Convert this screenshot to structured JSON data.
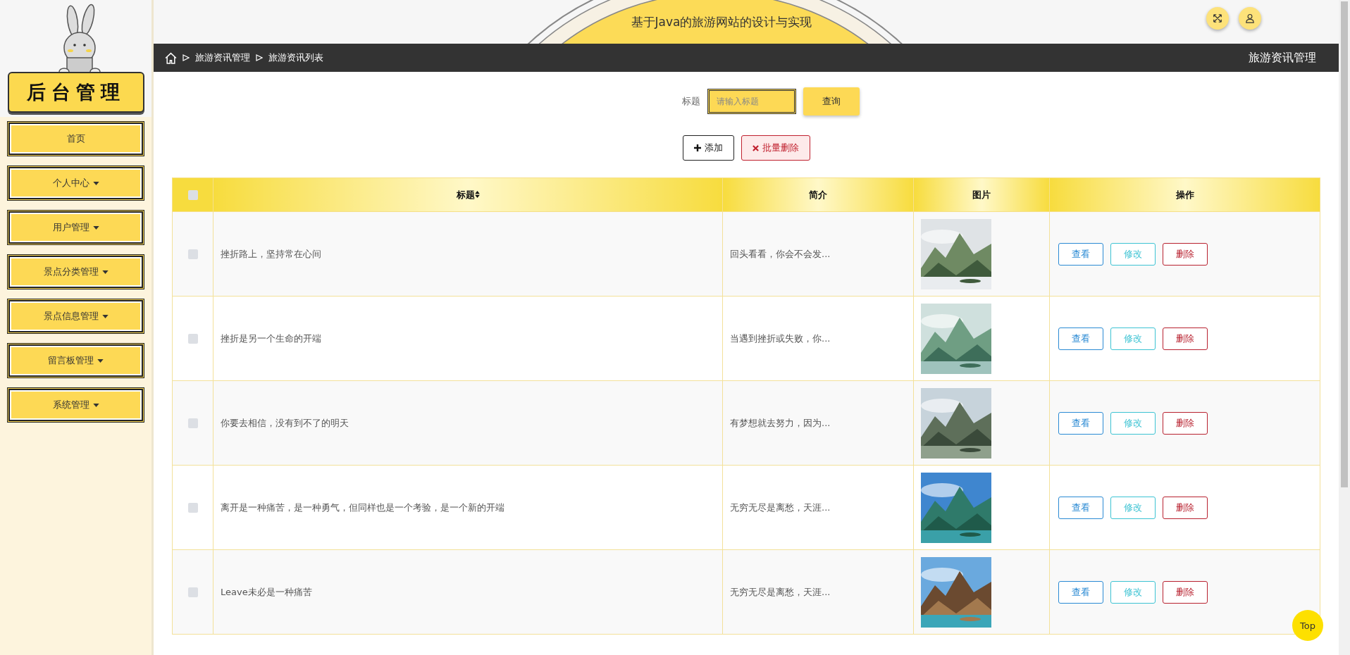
{
  "sidebar": {
    "title": "后台管理",
    "items": [
      {
        "label": "首页",
        "has_menu": false
      },
      {
        "label": "个人中心",
        "has_menu": true
      },
      {
        "label": "用户管理",
        "has_menu": true
      },
      {
        "label": "景点分类管理",
        "has_menu": true
      },
      {
        "label": "景点信息管理",
        "has_menu": true
      },
      {
        "label": "留言板管理",
        "has_menu": true
      },
      {
        "label": "系统管理",
        "has_menu": true
      }
    ]
  },
  "header": {
    "title": "基于Java的旅游网站的设计与实现"
  },
  "breadcrumb": {
    "items": [
      "旅游资讯管理",
      "旅游资讯列表"
    ],
    "page_title": "旅游资讯管理"
  },
  "search": {
    "label": "标题",
    "placeholder": "请输入标题",
    "button": "查询"
  },
  "actions": [
    {
      "kind": "add",
      "label": "添加"
    },
    {
      "kind": "delete",
      "label": "批量删除"
    }
  ],
  "table": {
    "columns": [
      "标题",
      "简介",
      "图片",
      "操作"
    ],
    "all_checked": false,
    "rows": [
      {
        "checked": false,
        "title": "挫折路上，坚持常在心间",
        "summary": "回头看看，你会不会发...",
        "picture": {
          "kind": "picture"
        },
        "buttons": [
          {
            "kind": "view",
            "label": "查看"
          },
          {
            "kind": "edit",
            "label": "修改"
          },
          {
            "kind": "delete",
            "label": "删除"
          }
        ]
      },
      {
        "checked": false,
        "title": "挫折是另一个生命的开端",
        "summary": "当遇到挫折或失败，你...",
        "picture": {
          "kind": "picture"
        },
        "buttons": [
          {
            "kind": "view",
            "label": "查看"
          },
          {
            "kind": "edit",
            "label": "修改"
          },
          {
            "kind": "delete",
            "label": "删除"
          }
        ]
      },
      {
        "checked": false,
        "title": "你要去相信，没有到不了的明天",
        "summary": "有梦想就去努力，因为...",
        "picture": {
          "kind": "picture"
        },
        "buttons": [
          {
            "kind": "view",
            "label": "查看"
          },
          {
            "kind": "edit",
            "label": "修改"
          },
          {
            "kind": "delete",
            "label": "删除"
          }
        ]
      },
      {
        "checked": false,
        "title": "离开是一种痛苦，是一种勇气，但同样也是一个考验，是一个新的开端",
        "summary": "无穷无尽是离愁，天涯...",
        "picture": {
          "kind": "picture"
        },
        "buttons": [
          {
            "kind": "view",
            "label": "查看"
          },
          {
            "kind": "edit",
            "label": "修改"
          },
          {
            "kind": "delete",
            "label": "删除"
          }
        ]
      },
      {
        "checked": false,
        "title": "Leave未必是一种痛苦",
        "summary": "无穷无尽是离愁，天涯...",
        "picture": {
          "kind": "picture"
        },
        "buttons": [
          {
            "kind": "view",
            "label": "查看"
          },
          {
            "kind": "edit",
            "label": "修改"
          },
          {
            "kind": "delete",
            "label": "删除"
          }
        ]
      }
    ]
  },
  "back_to_top": "Top"
}
